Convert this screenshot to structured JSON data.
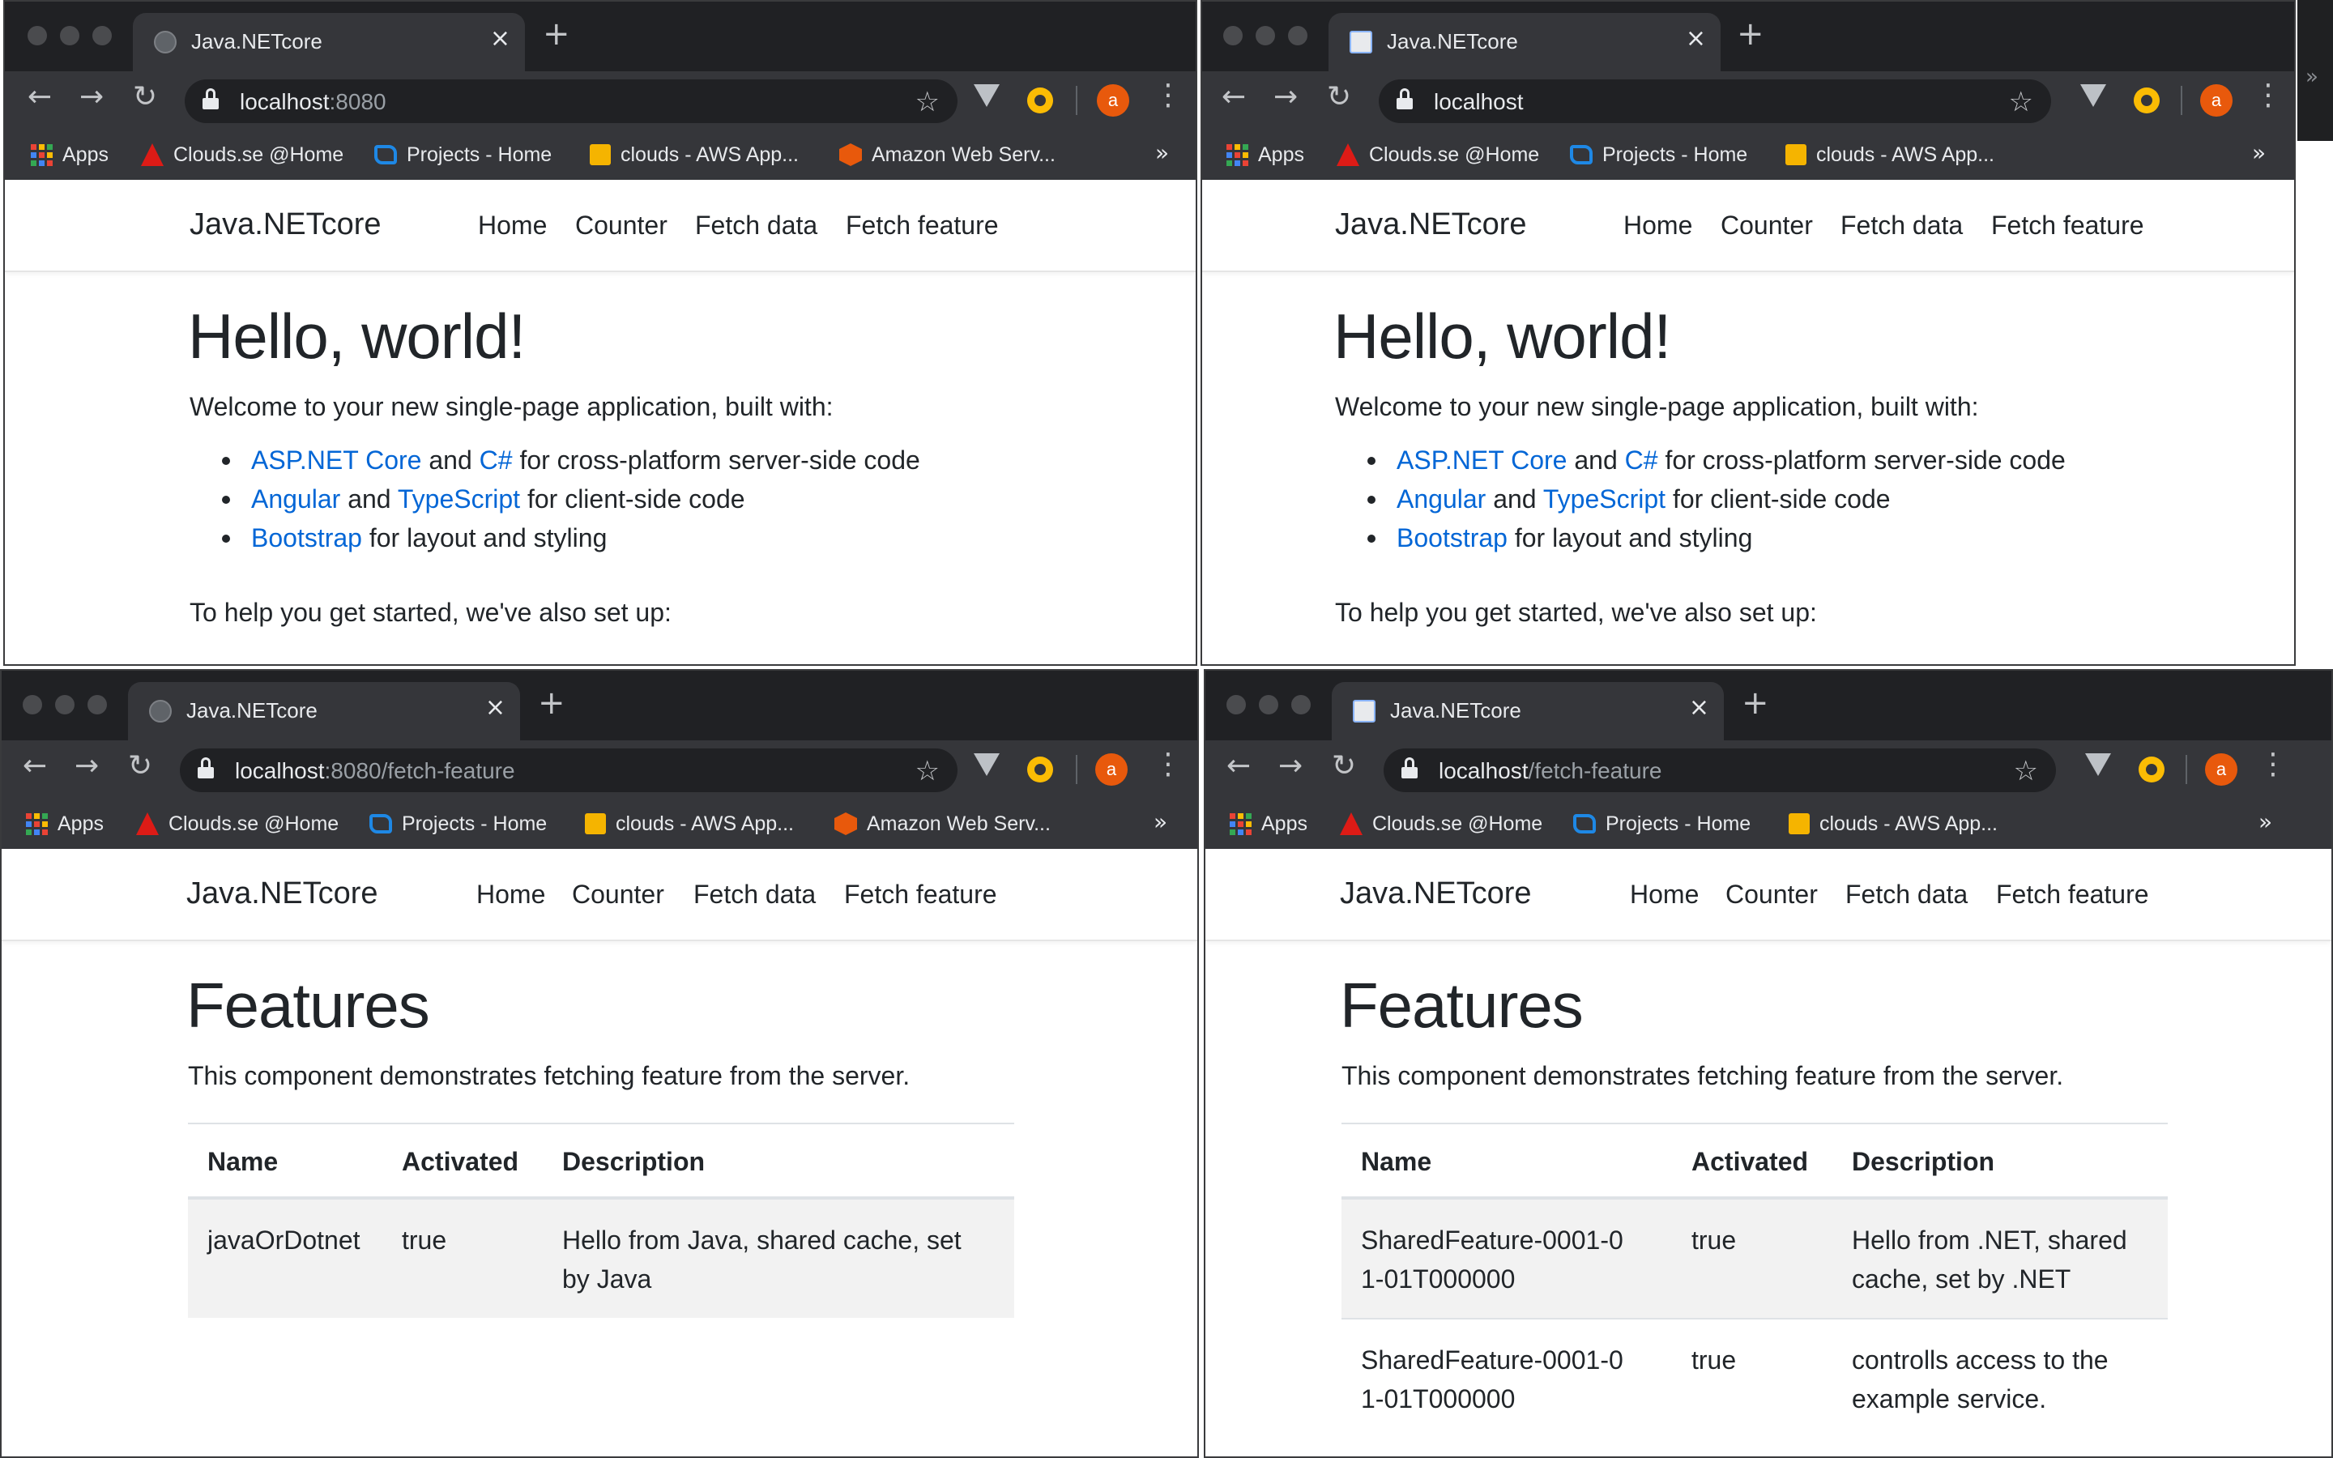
{
  "browser": {
    "tab_close": "×",
    "new_tab": "+",
    "back": "←",
    "forward": "→",
    "reload": "↻",
    "star": "☆",
    "menu": "⋮",
    "avatar_letter": "a",
    "bookmarks_overflow": "»",
    "bookmarks": {
      "apps": "Apps",
      "clouds_home": "Clouds.se @Home",
      "projects_home": "Projects - Home",
      "clouds_aws": "clouds - AWS App...",
      "amazon_web_services": "Amazon Web Serv..."
    }
  },
  "windows": {
    "tl": {
      "tab_title": "Java.NETcore",
      "url_host": "localhost",
      "url_rest": ":8080"
    },
    "tr": {
      "tab_title": "Java.NETcore",
      "url_host": "localhost",
      "url_rest": ""
    },
    "bl": {
      "tab_title": "Java.NETcore",
      "url_host": "localhost",
      "url_rest": ":8080/fetch-feature"
    },
    "br": {
      "tab_title": "Java.NETcore",
      "url_host": "localhost",
      "url_rest": "/fetch-feature"
    }
  },
  "app": {
    "brand": "Java.NETcore",
    "nav": {
      "home": "Home",
      "counter": "Counter",
      "fetch_data": "Fetch data",
      "fetch_feature": "Fetch feature"
    }
  },
  "home": {
    "heading": "Hello, world!",
    "welcome": "Welcome to your new single-page application, built with:",
    "bullets": {
      "aspnet_link": "ASP.NET Core",
      "and": "and",
      "csharp_link": "C#",
      "server_text": "for cross-platform server-side code",
      "angular_link": "Angular",
      "typescript_link": "TypeScript",
      "client_text": "for client-side code",
      "bootstrap_link": "Bootstrap",
      "layout_text": "for layout and styling"
    },
    "help": "To help you get started, we've also set up:"
  },
  "features": {
    "heading": "Features",
    "intro": "This component demonstrates fetching feature from the server.",
    "columns": {
      "name": "Name",
      "activated": "Activated",
      "description": "Description"
    },
    "java_rows": [
      {
        "name": "javaOrDotnet",
        "activated": "true",
        "description": "Hello from Java, shared cache, set by Java"
      }
    ],
    "dotnet_rows": [
      {
        "name": "SharedFeature-0001-01-01T000000",
        "activated": "true",
        "description": "Hello from .NET, shared cache, set by .NET"
      },
      {
        "name": "SharedFeature-0001-01-01T000000",
        "activated": "true",
        "description": "controlls access to the example service."
      }
    ]
  },
  "colors": {
    "link": "#0366d6",
    "chrome_dark": "#202124",
    "chrome_toolbar": "#35363a",
    "avatar": "#e8590c",
    "table_stripe": "#f2f2f2"
  }
}
